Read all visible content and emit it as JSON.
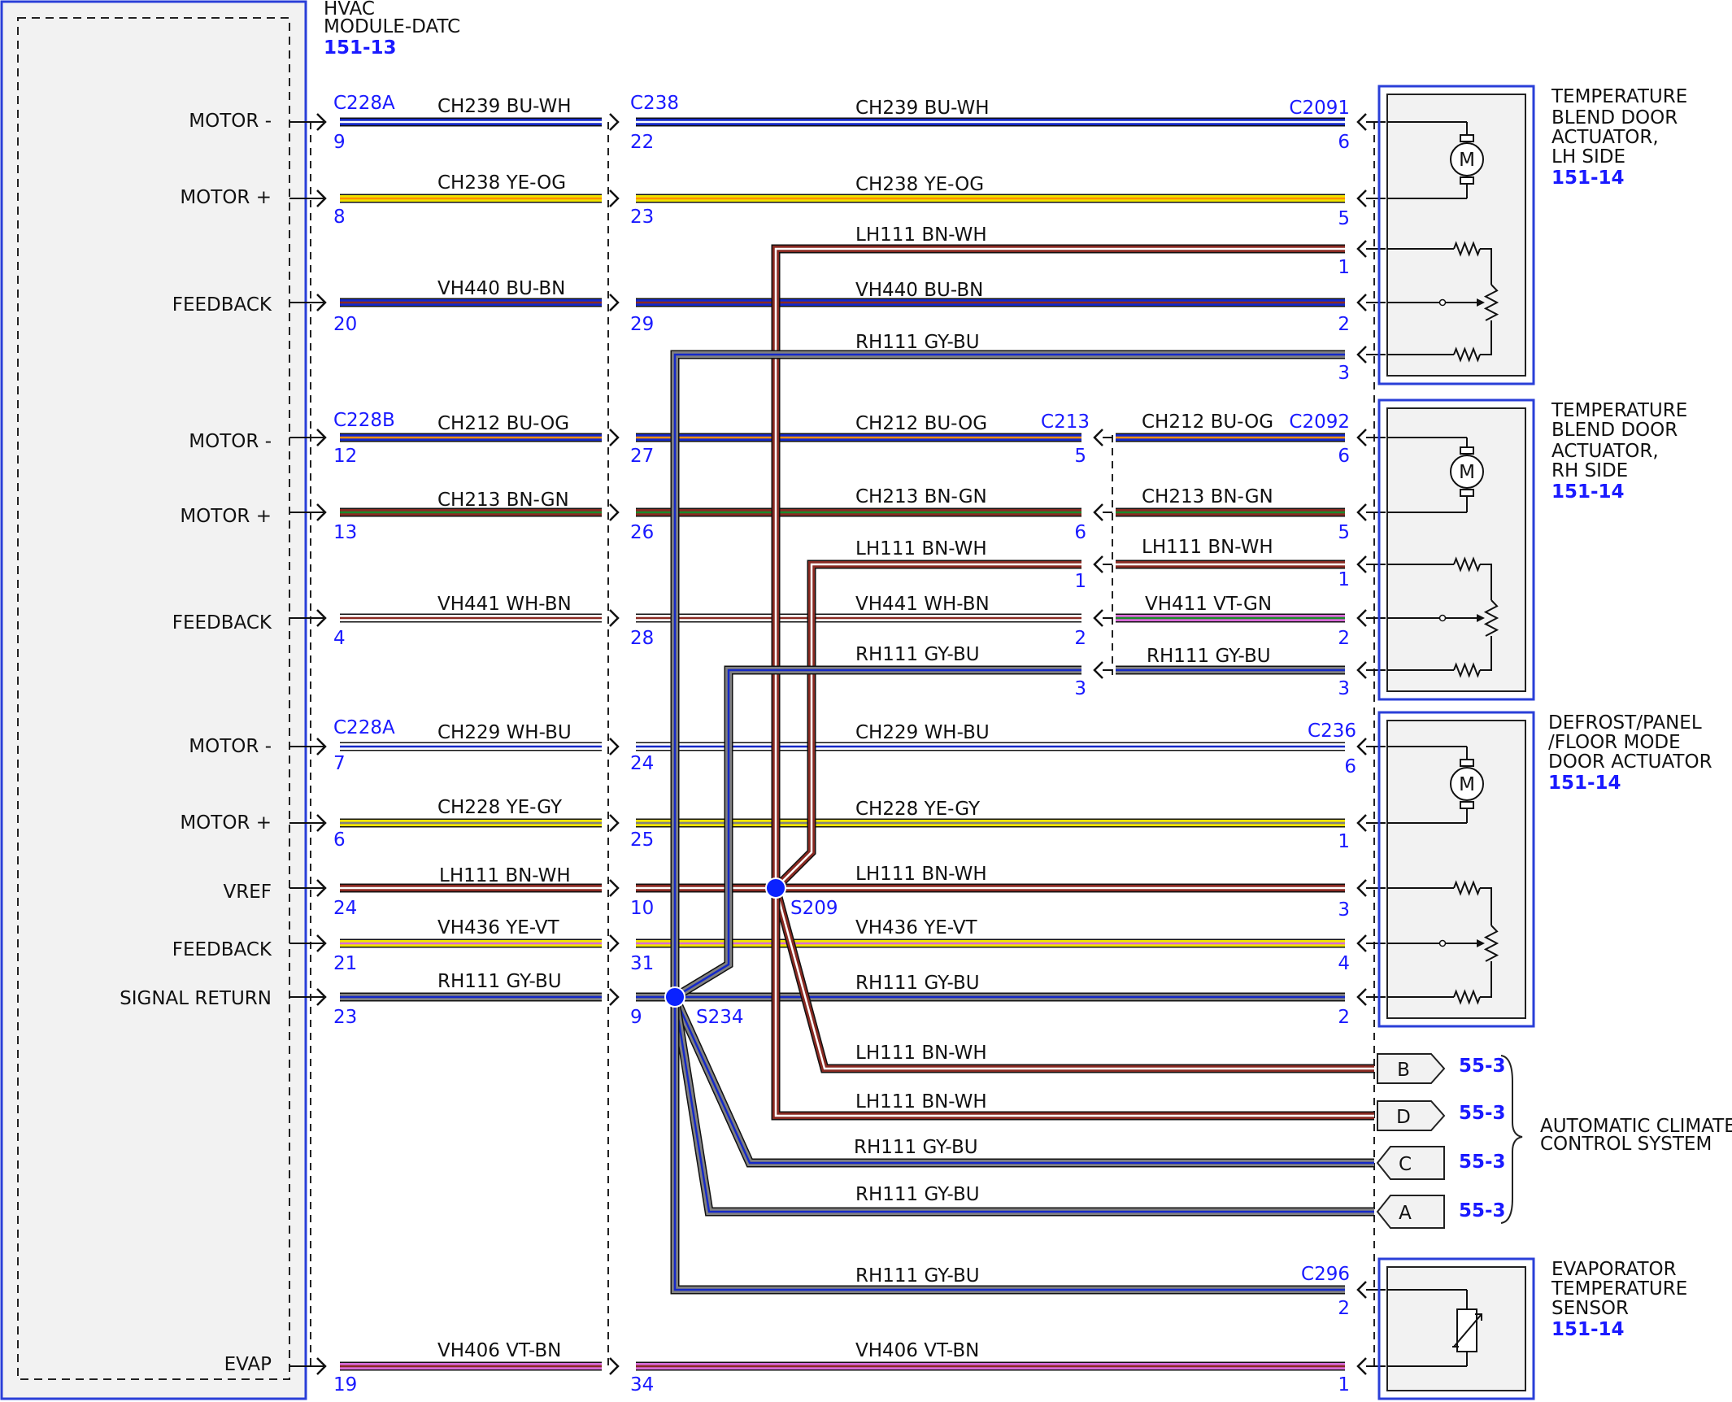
{
  "colors": {
    "BU": "#1428c8",
    "YE": "#f0e400",
    "BN": "#8a2a22",
    "WH": "#ffffff",
    "GY": "#808080",
    "VT": "#d86ad8",
    "GN": "#1a8a2a",
    "OG": "#ff9000",
    "accent": "#0000ff",
    "frame": "#2a3fd8"
  },
  "module": {
    "title1": "HVAC",
    "title2": "MODULE-DATC",
    "ref": "151-13"
  },
  "left_labels": [
    {
      "id": "l1",
      "text": "MOTOR -"
    },
    {
      "id": "l2",
      "text": "MOTOR +"
    },
    {
      "id": "l3",
      "text": "FEEDBACK"
    },
    {
      "id": "l4",
      "text": "MOTOR -"
    },
    {
      "id": "l5",
      "text": "MOTOR +"
    },
    {
      "id": "l6",
      "text": "FEEDBACK"
    },
    {
      "id": "l7",
      "text": "MOTOR -"
    },
    {
      "id": "l8",
      "text": "MOTOR +"
    },
    {
      "id": "l9",
      "text": "VREF"
    },
    {
      "id": "l10",
      "text": "FEEDBACK"
    },
    {
      "id": "l11",
      "text": "SIGNAL RETURN"
    },
    {
      "id": "l12",
      "text": "EVAP"
    }
  ],
  "connectors": {
    "c228a_top": "C228A",
    "c238": "C238",
    "c2091": "C2091",
    "c228b": "C228B",
    "c213": "C213",
    "c2092": "C2092",
    "c228a_mid": "C228A",
    "c236": "C236",
    "c296": "C296"
  },
  "pins": {
    "p_9a": "9",
    "p_8": "8",
    "p_20": "20",
    "p_12": "12",
    "p_13": "13",
    "p_4": "4",
    "p_7": "7",
    "p_6a": "6",
    "p_24a": "24",
    "p_21": "21",
    "p_23": "23",
    "p_19": "19",
    "p_22": "22",
    "p_23b": "23",
    "p_29": "29",
    "p_27": "27",
    "p_26": "26",
    "p_28": "28",
    "p_24b": "24",
    "p_25": "25",
    "p_10": "10",
    "p_31": "31",
    "p_9b": "9",
    "p_34": "34",
    "r_6a": "6",
    "r_5a": "5",
    "r_1a": "1",
    "r_2a": "2",
    "r_3a": "3",
    "m_5": "5",
    "m_6": "6",
    "m_1": "1",
    "m_2": "2",
    "m_3": "3",
    "r_6b": "6",
    "r_5b": "5",
    "r_1b": "1",
    "r_2b": "2",
    "r_3b": "3",
    "r_6c": "6",
    "r_1c": "1",
    "r_3c": "3",
    "r_4c": "4",
    "r_2c": "2",
    "r_2d": "2",
    "r_1d": "1"
  },
  "wires": {
    "w1a": "CH239   BU-WH",
    "w1b": "CH239   BU-WH",
    "w2a": "CH238   YE-OG",
    "w2b": "CH238   YE-OG",
    "w3": "LH111   BN-WH",
    "w4a": "VH440   BU-BN",
    "w4b": "VH440   BU-BN",
    "w5": "RH111   GY-BU",
    "w6a": "CH212   BU-OG",
    "w6b": "CH212   BU-OG",
    "w6c": "CH212   BU-OG",
    "w7a": "CH213   BN-GN",
    "w7b": "CH213   BN-GN",
    "w7c": "CH213   BN-GN",
    "w8b": "LH111   BN-WH",
    "w8c": "LH111   BN-WH",
    "w9a": "VH441   WH-BN",
    "w9b": "VH441   WH-BN",
    "w9c": "VH411   VT-GN",
    "w10b": "RH111   GY-BU",
    "w10c": "RH111   GY-BU",
    "w11a": "CH229   WH-BU",
    "w11b": "CH229   WH-BU",
    "w12a": "CH228   YE-GY",
    "w12b": "CH228   YE-GY",
    "w13a": "LH111   BN-WH",
    "w13b": "LH111   BN-WH",
    "w14a": "VH436   YE-VT",
    "w14b": "VH436   YE-VT",
    "w15a": "RH111   GY-BU",
    "w15b": "RH111   GY-BU",
    "w16": "LH111   BN-WH",
    "w17": "LH111   BN-WH",
    "w18": "RH111   GY-BU",
    "w19": "RH111   GY-BU",
    "w20": "RH111   GY-BU",
    "w21a": "VH406   VT-BN",
    "w21b": "VH406   VT-BN"
  },
  "splices": {
    "s209": "S209",
    "s234": "S234"
  },
  "components": {
    "lh": {
      "l1": "TEMPERATURE",
      "l2": "BLEND DOOR",
      "l3": "ACTUATOR,",
      "l4": "LH SIDE",
      "ref": "151-14"
    },
    "rh": {
      "l1": "TEMPERATURE",
      "l2": "BLEND DOOR",
      "l3": "ACTUATOR,",
      "l4": "RH SIDE",
      "ref": "151-14"
    },
    "mode": {
      "l1": "DEFROST/PANEL",
      "l2": "/FLOOR MODE",
      "l3": "DOOR ACTUATOR",
      "ref": "151-14"
    },
    "evap": {
      "l1": "EVAPORATOR",
      "l2": "TEMPERATURE",
      "l3": "SENSOR",
      "ref": "151-14"
    }
  },
  "offpage": {
    "b": {
      "letter": "B",
      "ref": "55-3"
    },
    "d": {
      "letter": "D",
      "ref": "55-3"
    },
    "c": {
      "letter": "C",
      "ref": "55-3"
    },
    "a": {
      "letter": "A",
      "ref": "55-3"
    },
    "system1": "AUTOMATIC CLIMATE",
    "system2": "CONTROL SYSTEM"
  },
  "motor_symbol": "M"
}
